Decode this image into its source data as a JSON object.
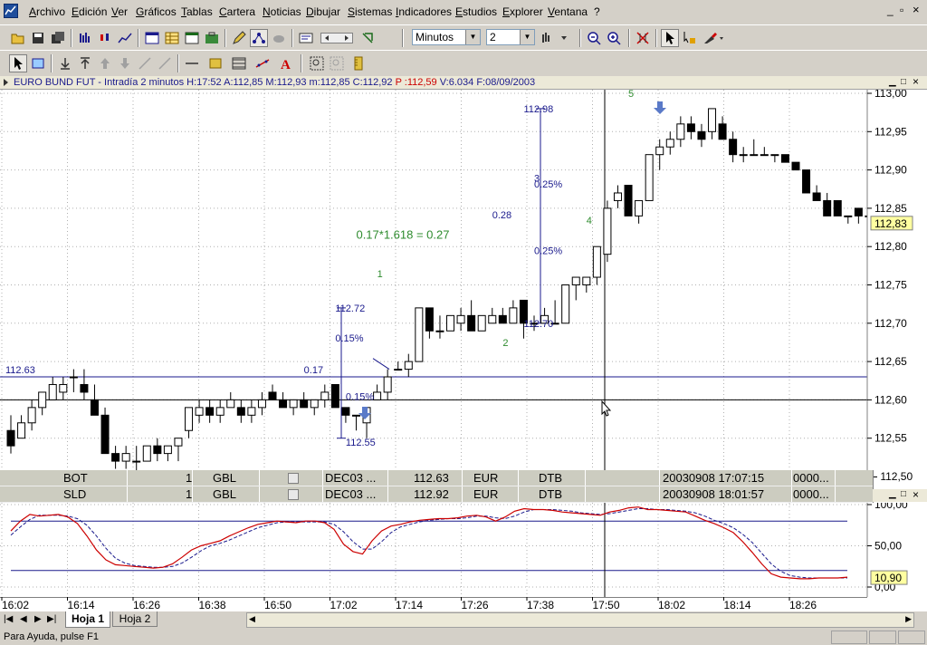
{
  "menu": {
    "items": [
      "Archivo",
      "Edición",
      "Ver",
      "Gráficos",
      "Tablas",
      "Cartera",
      "Noticias",
      "Dibujar",
      "Sistemas",
      "Indicadores",
      "Estudios",
      "Explorer",
      "Ventana",
      "?"
    ],
    "window_controls": [
      "_",
      "▫",
      "×"
    ]
  },
  "toolbar": {
    "interval_unit": "Minutos",
    "interval_value": "2"
  },
  "chart_window": {
    "title_label": "EURO BUND FUT - Intradía 2 minutos",
    "h_label": "H:",
    "h_val": "17:52",
    "a_label": "A:",
    "a_val": "112,85",
    "m_label": "M:",
    "m_val": "112,93",
    "mi_label": "m:",
    "mi_val": "112,85",
    "c_label": "C:",
    "c_val": "112,92",
    "p_label": "P :",
    "p_val": "112,59",
    "v_label": "V:",
    "v_val": "6.034",
    "f_label": "F:",
    "f_val": "08/09/2003"
  },
  "colors": {
    "up": "#ffffff",
    "down": "#000000",
    "annot_blue": "#1a1a8c",
    "annot_green": "#2e8b2e",
    "stoch_k": "#cc0000",
    "stoch_d": "#1a1a8c",
    "last_price_bg": "#ffffa0"
  },
  "chart_data": {
    "type": "candlestick",
    "y_axis_labels": [
      "113,00",
      "112,95",
      "112,90",
      "112,85",
      "112,80",
      "112,75",
      "112,70",
      "112,65",
      "112,60",
      "112,55",
      "112,50"
    ],
    "ylim": [
      112.5,
      113.0
    ],
    "last_price_label": "112,83",
    "x_axis_labels": [
      "16:02",
      "16:14",
      "16:26",
      "16:38",
      "16:50",
      "17:02",
      "17:14",
      "17:26",
      "17:38",
      "17:50",
      "18:02",
      "18:14",
      "18:26"
    ],
    "candles": [
      [
        112.56,
        112.58,
        112.53,
        112.54
      ],
      [
        112.55,
        112.58,
        112.55,
        112.57
      ],
      [
        112.57,
        112.6,
        112.56,
        112.59
      ],
      [
        112.59,
        112.61,
        112.58,
        112.61
      ],
      [
        112.6,
        112.63,
        112.6,
        112.62
      ],
      [
        112.61,
        112.63,
        112.6,
        112.62
      ],
      [
        112.63,
        112.64,
        112.61,
        112.63
      ],
      [
        112.62,
        112.64,
        112.6,
        112.61
      ],
      [
        112.6,
        112.62,
        112.58,
        112.58
      ],
      [
        112.58,
        112.59,
        112.53,
        112.53
      ],
      [
        112.53,
        112.54,
        112.51,
        112.52
      ],
      [
        112.52,
        112.54,
        112.51,
        112.53
      ],
      [
        112.52,
        112.54,
        112.5,
        112.52
      ],
      [
        112.52,
        112.54,
        112.52,
        112.54
      ],
      [
        112.54,
        112.55,
        112.52,
        112.53
      ],
      [
        112.53,
        112.54,
        112.52,
        112.54
      ],
      [
        112.54,
        112.55,
        112.52,
        112.55
      ],
      [
        112.56,
        112.59,
        112.55,
        112.59
      ],
      [
        112.58,
        112.6,
        112.57,
        112.59
      ],
      [
        112.59,
        112.6,
        112.57,
        112.58
      ],
      [
        112.58,
        112.6,
        112.57,
        112.59
      ],
      [
        112.59,
        112.61,
        112.59,
        112.6
      ],
      [
        112.59,
        112.6,
        112.57,
        112.58
      ],
      [
        112.58,
        112.6,
        112.57,
        112.59
      ],
      [
        112.59,
        112.61,
        112.58,
        112.6
      ],
      [
        112.61,
        112.62,
        112.6,
        112.6
      ],
      [
        112.6,
        112.61,
        112.59,
        112.59
      ],
      [
        112.59,
        112.6,
        112.58,
        112.6
      ],
      [
        112.6,
        112.61,
        112.59,
        112.59
      ],
      [
        112.59,
        112.6,
        112.58,
        112.6
      ],
      [
        112.6,
        112.62,
        112.59,
        112.61
      ],
      [
        112.62,
        112.62,
        112.59,
        112.59
      ],
      [
        112.59,
        112.59,
        112.57,
        112.58
      ],
      [
        112.58,
        112.58,
        112.56,
        112.58
      ],
      [
        112.57,
        112.59,
        112.55,
        112.59
      ],
      [
        112.6,
        112.62,
        112.6,
        112.61
      ],
      [
        112.61,
        112.64,
        112.6,
        112.63
      ],
      [
        112.64,
        112.65,
        112.64,
        112.64
      ],
      [
        112.64,
        112.66,
        112.63,
        112.65
      ],
      [
        112.65,
        112.72,
        112.65,
        112.72
      ],
      [
        112.72,
        112.72,
        112.68,
        112.69
      ],
      [
        112.69,
        112.71,
        112.68,
        112.69
      ],
      [
        112.69,
        112.71,
        112.69,
        112.71
      ],
      [
        112.7,
        112.72,
        112.69,
        112.71
      ],
      [
        112.71,
        112.73,
        112.69,
        112.69
      ],
      [
        112.69,
        112.71,
        112.69,
        112.71
      ],
      [
        112.7,
        112.72,
        112.7,
        112.71
      ],
      [
        112.71,
        112.72,
        112.7,
        112.7
      ],
      [
        112.7,
        112.73,
        112.7,
        112.72
      ],
      [
        112.73,
        112.73,
        112.68,
        112.7
      ],
      [
        112.7,
        112.71,
        112.69,
        112.7
      ],
      [
        112.7,
        112.72,
        112.7,
        112.71
      ],
      [
        112.7,
        112.73,
        112.7,
        112.7
      ],
      [
        112.7,
        112.75,
        112.7,
        112.75
      ],
      [
        112.75,
        112.76,
        112.73,
        112.76
      ],
      [
        112.75,
        112.76,
        112.74,
        112.76
      ],
      [
        112.76,
        112.8,
        112.75,
        112.8
      ],
      [
        112.79,
        112.86,
        112.78,
        112.85
      ],
      [
        112.86,
        112.88,
        112.85,
        112.87
      ],
      [
        112.88,
        112.88,
        112.84,
        112.84
      ],
      [
        112.84,
        112.86,
        112.83,
        112.86
      ],
      [
        112.86,
        112.92,
        112.86,
        112.92
      ],
      [
        112.92,
        112.94,
        112.9,
        112.93
      ],
      [
        112.93,
        112.95,
        112.92,
        112.94
      ],
      [
        112.94,
        112.97,
        112.93,
        112.96
      ],
      [
        112.96,
        112.97,
        112.94,
        112.95
      ],
      [
        112.95,
        112.96,
        112.93,
        112.94
      ],
      [
        112.95,
        112.98,
        112.94,
        112.98
      ],
      [
        112.96,
        112.97,
        112.94,
        112.94
      ],
      [
        112.94,
        112.95,
        112.91,
        112.92
      ],
      [
        112.92,
        112.93,
        112.91,
        112.92
      ],
      [
        112.92,
        112.94,
        112.92,
        112.92
      ],
      [
        112.92,
        112.93,
        112.92,
        112.92
      ],
      [
        112.92,
        112.92,
        112.91,
        112.92
      ],
      [
        112.92,
        112.92,
        112.91,
        112.91
      ],
      [
        112.91,
        112.91,
        112.9,
        112.9
      ],
      [
        112.9,
        112.9,
        112.87,
        112.87
      ],
      [
        112.87,
        112.88,
        112.86,
        112.86
      ],
      [
        112.86,
        112.87,
        112.84,
        112.84
      ],
      [
        112.86,
        112.86,
        112.84,
        112.84
      ],
      [
        112.84,
        112.84,
        112.83,
        112.84
      ],
      [
        112.85,
        112.85,
        112.83,
        112.84
      ],
      [
        112.84,
        112.84,
        112.83,
        112.84
      ],
      [
        112.84,
        112.85,
        112.83,
        112.84
      ],
      [
        112.84,
        112.84,
        112.83,
        112.83
      ],
      [
        112.84,
        112.84,
        112.82,
        112.82
      ],
      [
        112.83,
        112.83,
        112.81,
        112.82
      ]
    ],
    "horizontal_lines": [
      112.63,
      112.6
    ],
    "vertical_line_label": "17:50",
    "annotations": [
      {
        "text": "112.63",
        "price": 112.635,
        "bar": 0
      },
      {
        "text": "0.17",
        "price": 112.635,
        "bar": 28
      },
      {
        "text": "112.72",
        "price": 112.715,
        "bar": 31
      },
      {
        "text": "0.15%",
        "price": 112.676,
        "bar": 31
      },
      {
        "text": "0.15%",
        "price": 112.6,
        "bar": 32
      },
      {
        "text": "112.55",
        "price": 112.54,
        "bar": 32
      },
      {
        "text": "0.17*1.618 = 0.27",
        "price": 112.81,
        "bar": 33
      },
      {
        "text": "1",
        "price": 112.76,
        "bar": 35
      },
      {
        "text": "2",
        "price": 112.67,
        "bar": 47
      },
      {
        "text": "0.28",
        "price": 112.837,
        "bar": 46
      },
      {
        "text": "112.98",
        "price": 112.975,
        "bar": 49
      },
      {
        "text": "3",
        "price": 112.885,
        "bar": 50
      },
      {
        "text": "0.25%",
        "price": 112.877,
        "bar": 50
      },
      {
        "text": "0.25%",
        "price": 112.79,
        "bar": 50
      },
      {
        "text": "112.70",
        "price": 112.695,
        "bar": 49
      },
      {
        "text": "4",
        "price": 112.83,
        "bar": 55
      },
      {
        "text": "5",
        "price": 112.995,
        "bar": 59
      }
    ],
    "title": "EURO BUND FUT - Intradía 2 minutos"
  },
  "trades": [
    {
      "side": "BOT",
      "qty": "1",
      "symbol": "GBL",
      "expiry": "DEC03 ...",
      "price": "112.63",
      "currency": "EUR",
      "exchange": "DTB",
      "time": "20030908  17:07:15",
      "id": "0000..."
    },
    {
      "side": "SLD",
      "qty": "1",
      "symbol": "GBL",
      "expiry": "DEC03 ...",
      "price": "112.92",
      "currency": "EUR",
      "exchange": "DTB",
      "time": "20030908  18:01:57",
      "id": "0000..."
    }
  ],
  "oscillator": {
    "y_axis_labels": [
      "100,00",
      "50,00",
      "0,00"
    ],
    "last_value_label": "10,90",
    "k": [
      68,
      80,
      88,
      86,
      87,
      88,
      85,
      77,
      62,
      45,
      33,
      27,
      26,
      25,
      24,
      23,
      24,
      28,
      36,
      45,
      50,
      53,
      56,
      62,
      67,
      72,
      76,
      78,
      80,
      79,
      78,
      80,
      80,
      78,
      70,
      52,
      43,
      40,
      56,
      68,
      74,
      76,
      79,
      81,
      82,
      83,
      83,
      84,
      86,
      87,
      85,
      80,
      85,
      92,
      95,
      94,
      94,
      93,
      91,
      90,
      89,
      88,
      87,
      91,
      93,
      96,
      97,
      94,
      94,
      93,
      92,
      91,
      86,
      81,
      77,
      72,
      66,
      55,
      42,
      28,
      16,
      12,
      11,
      10,
      10,
      11,
      11,
      11,
      12
    ],
    "d": [
      63,
      73,
      82,
      87,
      87,
      87,
      86,
      83,
      75,
      62,
      47,
      35,
      29,
      26,
      25,
      24,
      24,
      25,
      29,
      36,
      44,
      50,
      53,
      57,
      62,
      67,
      72,
      75,
      78,
      79,
      79,
      79,
      79,
      79,
      76,
      67,
      55,
      46,
      46,
      55,
      66,
      73,
      76,
      79,
      81,
      82,
      83,
      83,
      84,
      86,
      86,
      84,
      83,
      86,
      91,
      94,
      94,
      94,
      93,
      92,
      90,
      89,
      88,
      89,
      91,
      93,
      95,
      95,
      94,
      94,
      93,
      92,
      90,
      86,
      81,
      77,
      72,
      64,
      54,
      41,
      28,
      19,
      14,
      12,
      11,
      11,
      11,
      11,
      11
    ]
  },
  "tabs": [
    "Hoja 1",
    "Hoja 2"
  ],
  "status": {
    "help_text": "Para Ayuda, pulse F1"
  }
}
